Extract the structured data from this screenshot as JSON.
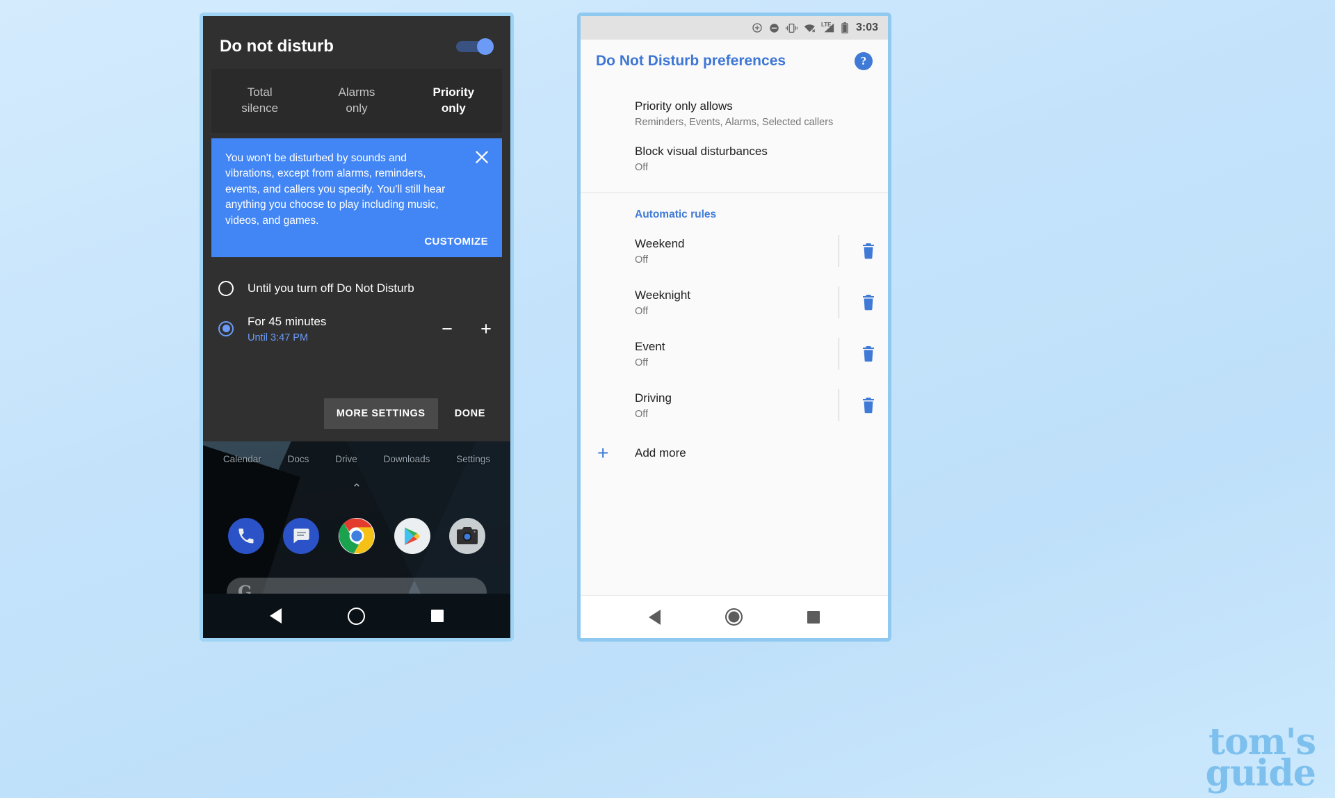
{
  "watermark": {
    "line1": "tom's",
    "line2": "guide"
  },
  "left_phone": {
    "dialog": {
      "title": "Do not disturb",
      "toggle_on": true,
      "modes": [
        {
          "label_line1": "Total",
          "label_line2": "silence",
          "active": false
        },
        {
          "label_line1": "Alarms",
          "label_line2": "only",
          "active": false
        },
        {
          "label_line1": "Priority",
          "label_line2": "only",
          "active": true
        }
      ],
      "info_card": {
        "text": "You won't be disturbed by sounds and vibrations, except from alarms, reminders, events, and callers you specify. You'll still hear anything you choose to play including music, videos, and games.",
        "action_label": "CUSTOMIZE",
        "close_icon": "close-icon",
        "background_color": "#4285f4"
      },
      "durations": [
        {
          "label": "Until you turn off Do Not Disturb",
          "sub": "",
          "selected": false,
          "has_stepper": false
        },
        {
          "label": "For 45 minutes",
          "sub": "Until 3:47 PM",
          "selected": true,
          "has_stepper": true,
          "minus_label": "−",
          "plus_label": "+"
        }
      ],
      "buttons": {
        "more_settings": "MORE SETTINGS",
        "done": "DONE"
      }
    },
    "home": {
      "app_labels": [
        "Calendar",
        "Docs",
        "Drive",
        "Downloads",
        "Settings"
      ],
      "drawer_chevron": "⌃",
      "dock_icons": [
        "phone-icon",
        "messages-icon",
        "chrome-icon",
        "play-store-icon",
        "camera-icon"
      ],
      "search_placeholder": "",
      "search_glyph": "G"
    },
    "navbar": [
      "back-button",
      "home-button",
      "recents-button"
    ]
  },
  "right_phone": {
    "status_bar": {
      "time": "3:03",
      "icons": [
        "data-saver-icon",
        "do-not-disturb-icon",
        "vibrate-icon",
        "wifi-off-icon",
        "lte-signal-icon",
        "battery-icon"
      ],
      "lte_label": "LTE"
    },
    "app_bar": {
      "title": "Do Not Disturb preferences",
      "help_icon": "help-icon",
      "help_glyph": "?"
    },
    "preferences": [
      {
        "title": "Priority only allows",
        "sub": "Reminders, Events, Alarms, Selected callers"
      },
      {
        "title": "Block visual disturbances",
        "sub": "Off"
      }
    ],
    "automatic_rules": {
      "heading": "Automatic rules",
      "rules": [
        {
          "title": "Weekend",
          "sub": "Off",
          "delete_icon": "trash-icon"
        },
        {
          "title": "Weeknight",
          "sub": "Off",
          "delete_icon": "trash-icon"
        },
        {
          "title": "Event",
          "sub": "Off",
          "delete_icon": "trash-icon"
        },
        {
          "title": "Driving",
          "sub": "Off",
          "delete_icon": "trash-icon"
        }
      ],
      "add_more": {
        "label": "Add more",
        "icon": "plus-icon",
        "glyph": "+"
      }
    },
    "navbar": [
      "back-button",
      "home-button",
      "recents-button"
    ]
  },
  "colors": {
    "accent_blue": "#4285f4",
    "link_blue": "#3f7ad6",
    "dialog_bg": "#303030",
    "page_bg": "#c9e6fb"
  }
}
